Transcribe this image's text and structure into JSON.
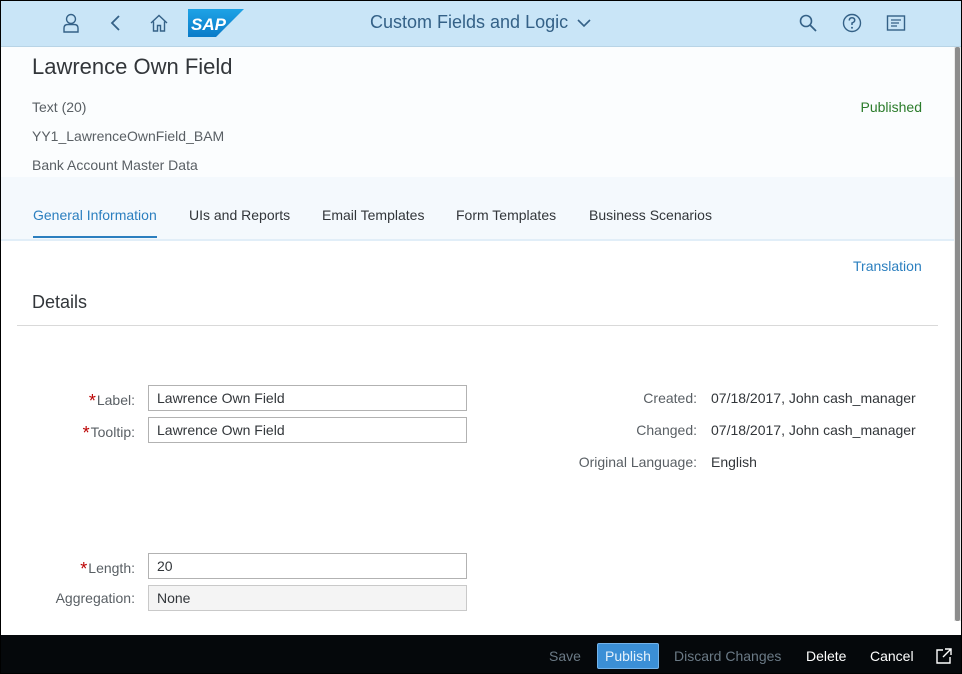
{
  "shell": {
    "app_title": "Custom Fields and Logic",
    "logo_text": "SAP",
    "icons": [
      "user-icon",
      "back-icon",
      "home-icon",
      "search-icon",
      "help-icon",
      "notifications-icon"
    ]
  },
  "header": {
    "title": "Lawrence Own Field",
    "type": "Text (20)",
    "identifier": "YY1_LawrenceOwnField_BAM",
    "business_context": "Bank Account Master Data",
    "status": "Published"
  },
  "tabs": [
    {
      "label": "General Information",
      "active": true
    },
    {
      "label": "UIs and Reports",
      "active": false
    },
    {
      "label": "Email Templates",
      "active": false
    },
    {
      "label": "Form Templates",
      "active": false
    },
    {
      "label": "Business Scenarios",
      "active": false
    }
  ],
  "translation_link": "Translation",
  "details": {
    "section_title": "Details",
    "required_marker": "*",
    "label": {
      "label": "Label:",
      "value": "Lawrence Own Field"
    },
    "tooltip": {
      "label": "Tooltip:",
      "value": "Lawrence Own Field"
    },
    "length": {
      "label": "Length:",
      "value": "20"
    },
    "aggregation": {
      "label": "Aggregation:",
      "value": "None"
    },
    "created": {
      "label": "Created:",
      "value": "07/18/2017, John cash_manager"
    },
    "changed": {
      "label": "Changed:",
      "value": "07/18/2017, John cash_manager"
    },
    "original_language": {
      "label": "Original Language:",
      "value": "English"
    }
  },
  "footer": {
    "save": "Save",
    "publish": "Publish",
    "discard": "Discard Changes",
    "delete": "Delete",
    "cancel": "Cancel"
  },
  "colors": {
    "shell_bg": "#c9e5f7",
    "accent": "#2b7fbf",
    "status_published": "#2b7c2b",
    "footer_bg": "#05080b",
    "required": "#bb0000"
  }
}
